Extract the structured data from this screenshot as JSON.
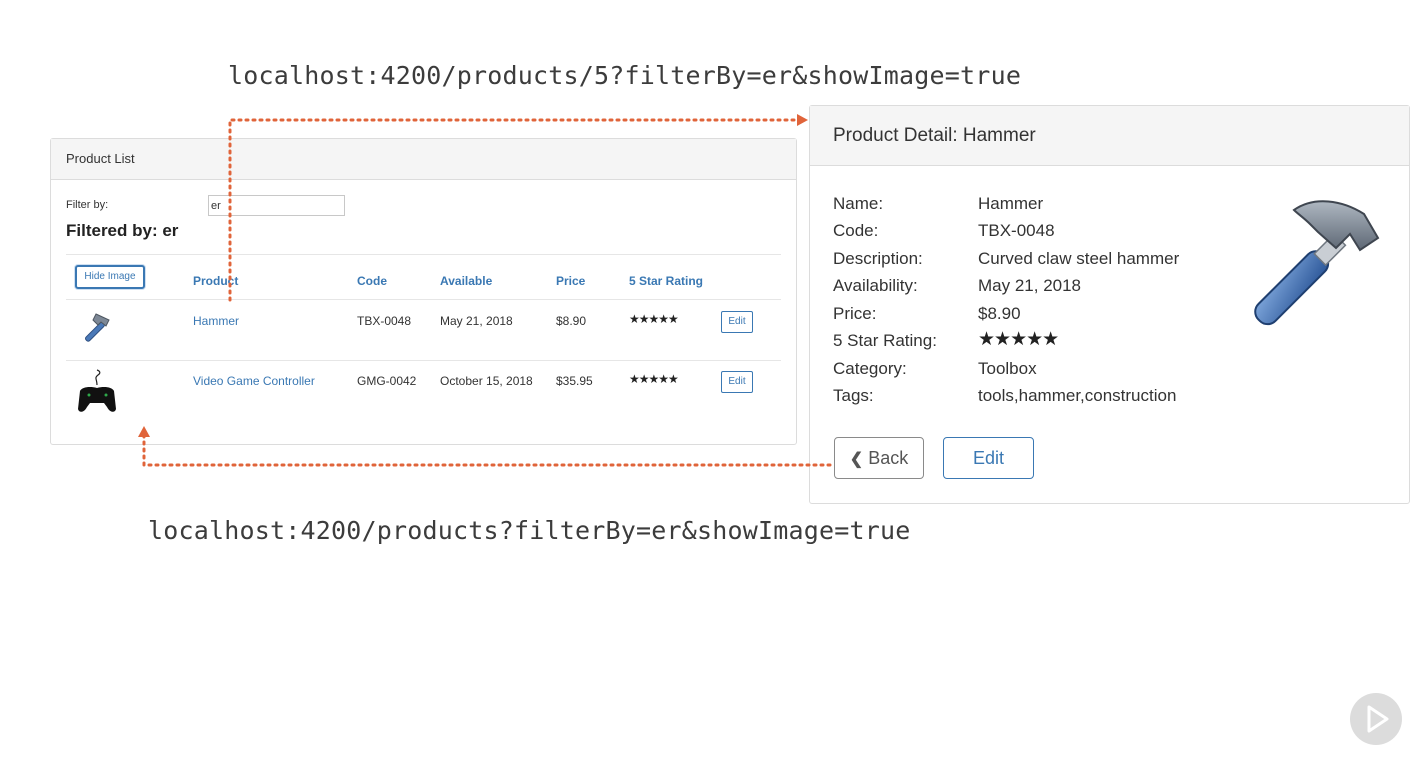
{
  "urls": {
    "detail": "localhost:4200/products/5?filterBy=er&showImage=true",
    "list": "localhost:4200/products?filterBy=er&showImage=true"
  },
  "product_list": {
    "title": "Product List",
    "filter_label": "Filter by:",
    "filter_value": "er",
    "filtered_by": "Filtered by: er",
    "hide_image_label": "Hide Image",
    "columns": [
      "Product",
      "Code",
      "Available",
      "Price",
      "5 Star Rating"
    ],
    "rows": [
      {
        "name": "Hammer",
        "code": "TBX-0048",
        "available": "May 21, 2018",
        "price": "$8.90",
        "rating": 5,
        "edit": "Edit",
        "icon": "hammer-icon"
      },
      {
        "name": "Video Game Controller",
        "code": "GMG-0042",
        "available": "October 15, 2018",
        "price": "$35.95",
        "rating": 4.8,
        "edit": "Edit",
        "icon": "game-controller-icon"
      }
    ]
  },
  "product_detail": {
    "title": "Product Detail: Hammer",
    "labels": {
      "name": "Name:",
      "code": "Code:",
      "description": "Description:",
      "availability": "Availability:",
      "price": "Price:",
      "rating": "5 Star Rating:",
      "category": "Category:",
      "tags": "Tags:"
    },
    "values": {
      "name": "Hammer",
      "code": "TBX-0048",
      "description": "Curved claw steel hammer",
      "availability": "May 21, 2018",
      "price": "$8.90",
      "rating": 5,
      "category": "Toolbox",
      "tags": "tools,hammer,construction"
    },
    "back_label": "Back",
    "edit_label": "Edit",
    "image": "hammer-icon"
  },
  "colors": {
    "arrow": "#e0643a",
    "link": "#3a78b3"
  },
  "icons": {
    "back": "chevron-left-icon",
    "star": "star-icon",
    "player": "play-icon"
  }
}
